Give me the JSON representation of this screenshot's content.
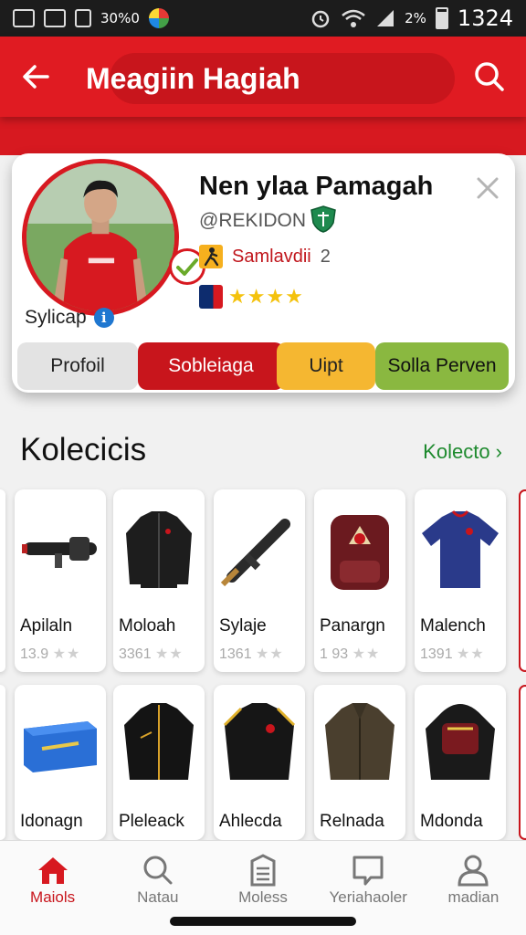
{
  "status_bar": {
    "left_text": "30%0",
    "battery": "2%",
    "time": "1324"
  },
  "app_bar": {
    "title": "Meagiin Hagiah"
  },
  "profile": {
    "name": "Nen ylaa Pamagah",
    "handle": "@REKIDON",
    "stat_label": "Samlavdii",
    "stat_value": "2",
    "rating": "★★★★",
    "caption": "Sylicap",
    "info_glyph": "i"
  },
  "tabs": [
    {
      "label": "Profoil",
      "color": "#e3e3e3"
    },
    {
      "label": "Sobleiaga",
      "color": "#c8151c"
    },
    {
      "label": "Uipt",
      "color": "#f5b731"
    },
    {
      "label": "Solla Perven",
      "color": "#8ab840"
    }
  ],
  "collection": {
    "title": "Kolecicis",
    "link": "Kolecto ›"
  },
  "items_row1": [
    {
      "name": "Apilaln",
      "meta": "13.9",
      "icon": "bazooka-icon"
    },
    {
      "name": "Moloah",
      "meta": "3361",
      "icon": "jacket-icon"
    },
    {
      "name": "Sylaje",
      "meta": "1361",
      "icon": "rifle-icon"
    },
    {
      "name": "Panargn",
      "meta": "1 93",
      "icon": "backpack-icon"
    },
    {
      "name": "Malench",
      "meta": "1391",
      "icon": "jersey-icon"
    }
  ],
  "items_row2": [
    {
      "name": "Idonagn",
      "icon": "box-icon"
    },
    {
      "name": "Pleleack",
      "icon": "jacket-icon"
    },
    {
      "name": "Ahlecda",
      "icon": "jacket-icon"
    },
    {
      "name": "Relnada",
      "icon": "leather-jacket-icon"
    },
    {
      "name": "Mdonda",
      "icon": "hoodie-icon"
    }
  ],
  "item_stars": "★★",
  "bottom_nav": [
    {
      "label": "Maiols",
      "icon": "home-icon",
      "active": true
    },
    {
      "label": "Natau",
      "icon": "search-icon",
      "active": false
    },
    {
      "label": "Moless",
      "icon": "document-icon",
      "active": false
    },
    {
      "label": "Yeriahaoler",
      "icon": "chat-icon",
      "active": false
    },
    {
      "label": "madian",
      "icon": "profile-icon",
      "active": false
    }
  ],
  "colors": {
    "brand_red": "#d71920",
    "link_green": "#1e8a2e",
    "star_gold": "#f4c20d"
  }
}
